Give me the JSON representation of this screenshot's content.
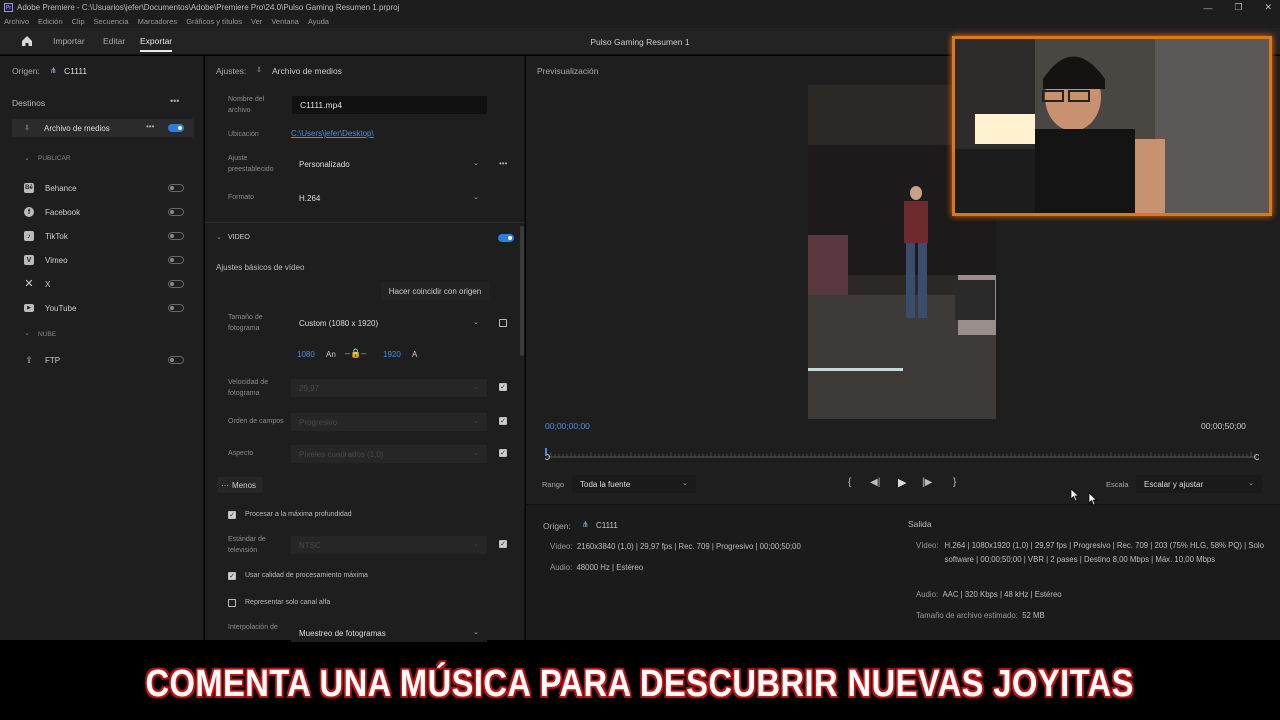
{
  "window": {
    "title": "Adobe Premiere - C:\\Usuarios\\jefer\\Documentos\\Adobe\\Premiere Pro\\24.0\\Pulso Gaming Resumen 1.prproj",
    "controls": [
      "—",
      "❐",
      "✕"
    ]
  },
  "menu": [
    "Archivo",
    "Edición",
    "Clip",
    "Secuencia",
    "Marcadores",
    "Gráficos y títulos",
    "Ver",
    "Ventana",
    "Ayuda"
  ],
  "header": {
    "tabs": [
      "Importar",
      "Editar",
      "Exportar"
    ],
    "active_tab": "Exportar",
    "project_title": "Pulso Gaming Resumen 1"
  },
  "left": {
    "origin_label": "Origen:",
    "origin_value": "C1111",
    "destinations_label": "Destinos",
    "media_file": "Archivo de medios",
    "publish_label": "PUBLICAR",
    "publish_items": [
      "Behance",
      "Facebook",
      "TikTok",
      "Vimeo",
      "X",
      "YouTube"
    ],
    "cloud_label": "NUBE",
    "cloud_items": [
      "FTP"
    ]
  },
  "settings": {
    "header_label": "Ajustes:",
    "header_value": "Archivo de medios",
    "filename_label": "Nombre del archivo",
    "filename": "C1111.mp4",
    "location_label": "Ubicación",
    "location": "C:\\Users\\jefer\\Desktop\\",
    "preset_label": "Ajuste preestablecido",
    "preset": "Personalizado",
    "format_label": "Formato",
    "format": "H.264",
    "video_section": "VIDEO",
    "basic_settings": "Ajustes básicos de vídeo",
    "match_source": "Hacer coincidir con origen",
    "frame_size_label": "Tamaño de fotograma",
    "frame_size": "Custom (1080 x 1920)",
    "width": "1080",
    "width_unit": "An",
    "height": "1920",
    "height_unit": "A",
    "framerate_label": "Velocidad de fotograma",
    "framerate": "29,97",
    "field_order_label": "Orden de campos",
    "field_order": "Progresivo",
    "aspect_label": "Aspecto",
    "aspect": "Píxeles cuadrados (1,0)",
    "less_button": "Menos",
    "max_depth": "Procesar a la máxima profundidad",
    "tv_standard_label": "Estándar de televisión",
    "tv_standard": "NTSC",
    "max_quality": "Usar calidad de procesamiento máxima",
    "alpha_only": "Representar solo canal alfa",
    "interp_label": "Interpolación de",
    "interp": "Muestreo de fotogramas"
  },
  "preview": {
    "label": "Previsualización",
    "timecode_start": "00;00;00;00",
    "timecode_end": "00;00;50;00",
    "range_label": "Rango",
    "range_value": "Toda la fuente",
    "scale_label": "Escala",
    "scale_value": "Escalar y ajustar"
  },
  "summary": {
    "origin_label": "Origen:",
    "origin_value": "C1111",
    "video_label": "Vídeo:",
    "video_value": "2160x3840 (1,0)  |  29,97 fps  |  Rec. 709  |  Progresivo  |  00;00;50;00",
    "audio_label": "Audio:",
    "audio_value": "48000 Hz  |  Estéreo",
    "output_label": "Salida",
    "out_video_label": "Vídeo:",
    "out_video_value": "H.264  |  1080x1920 (1,0)  |  29,97 fps  |  Progresivo  |  Rec. 709  |  203 (75% HLG, 58% PQ)  |  Solo software  |  00;00;50;00  |  VBR  |  2 pases  |  Destino 8,00 Mbps  |  Máx. 10,00 Mbps",
    "out_audio_label": "Audio:",
    "out_audio_value": "AAC  |  320 Kbps  |  48 kHz  |  Estéreo",
    "filesize_label": "Tamaño de archivo estimado:",
    "filesize_value": "52 MB"
  },
  "caption": "COMENTA UNA MÚSICA PARA DESCUBRIR NUEVAS JOYITAS",
  "colors": {
    "accent": "#2c7be5",
    "caption_glow": "#d01c1c",
    "webcam_frame": "#d97a1a"
  }
}
